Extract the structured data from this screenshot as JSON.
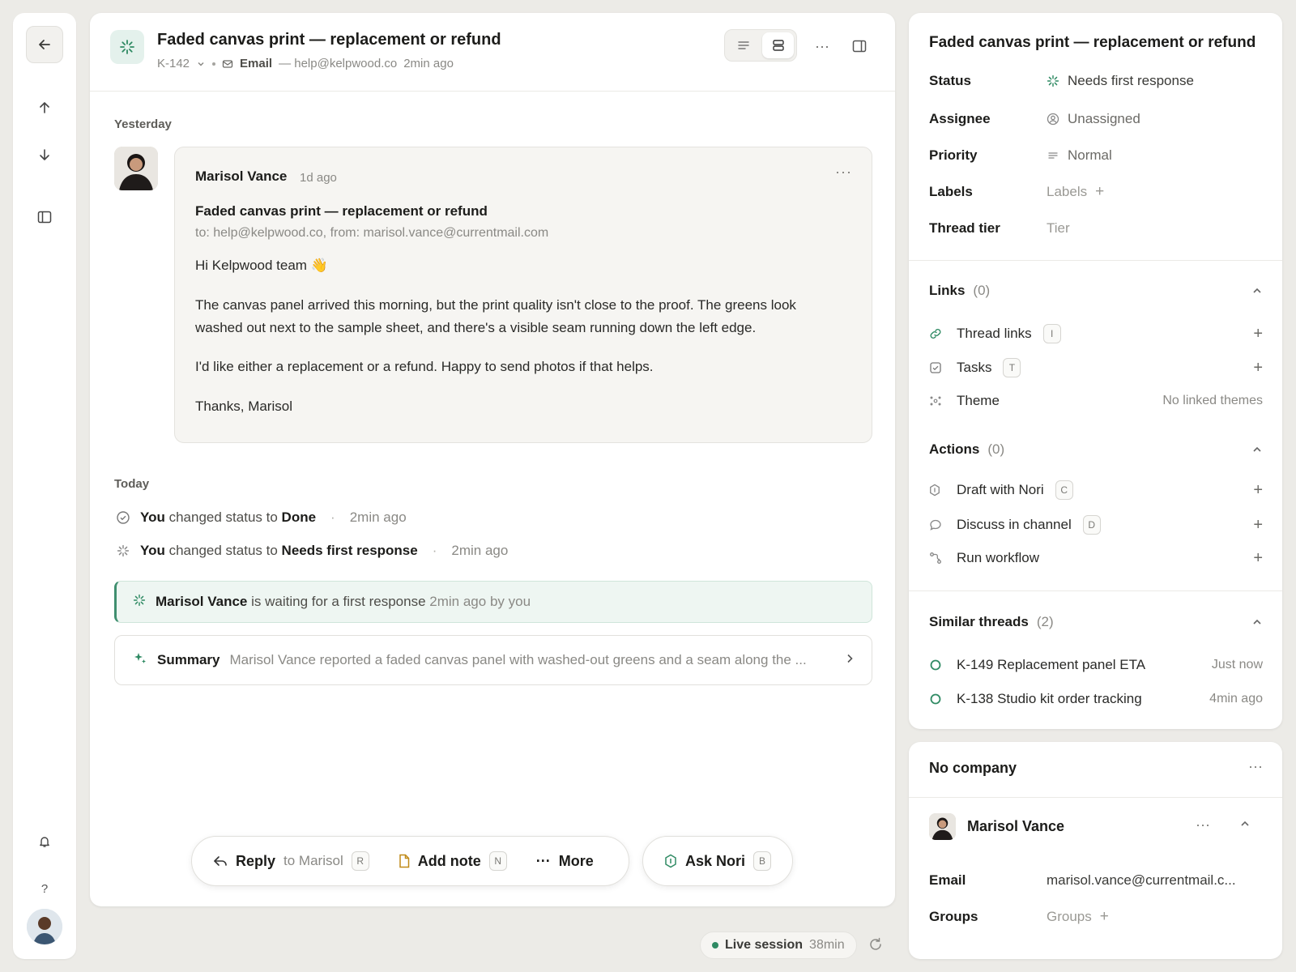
{
  "thread": {
    "title": "Faded canvas print — replacement or refund",
    "id": "K-142",
    "channel": "Email",
    "channel_addr": "— help@kelpwood.co",
    "age": "2min ago"
  },
  "timeline": {
    "yesterday": "Yesterday",
    "today": "Today",
    "message": {
      "sender": "Marisol Vance",
      "age": "1d ago",
      "subject": "Faded canvas print — replacement or refund",
      "addresses": "to: help@kelpwood.co, from: marisol.vance@currentmail.com",
      "greeting": "Hi Kelpwood team 👋",
      "p1": "The canvas panel arrived this morning, but the print quality isn't close to the proof. The greens look washed out next to the sample sheet, and there's a visible seam running down the left edge.",
      "p2": "I'd like either a replacement or a refund. Happy to send photos if that helps.",
      "signoff": "Thanks, Marisol"
    },
    "events": [
      {
        "actor": "You",
        "text": "changed status to",
        "value": "Done",
        "time": "2min ago"
      },
      {
        "actor": "You",
        "text": "changed status to",
        "value": "Needs first response",
        "time": "2min ago"
      }
    ],
    "waiting": {
      "name": "Marisol Vance",
      "text": "is waiting for a first response",
      "meta": "2min ago by you"
    },
    "summary": {
      "label": "Summary",
      "text": "Marisol Vance reported a faded canvas panel with washed-out greens and a seam along the ..."
    }
  },
  "actions_bar": {
    "reply": "Reply",
    "reply_to": "to Marisol",
    "reply_key": "R",
    "note": "Add note",
    "note_key": "N",
    "more": "More",
    "ask": "Ask Nori",
    "ask_key": "B"
  },
  "live": {
    "label": "Live session",
    "duration": "38min"
  },
  "details": {
    "title": "Faded canvas print — replacement or refund",
    "props": [
      {
        "k": "Status",
        "v": "Needs first response"
      },
      {
        "k": "Assignee",
        "v": "Unassigned"
      },
      {
        "k": "Priority",
        "v": "Normal"
      },
      {
        "k": "Labels",
        "v": "Labels"
      },
      {
        "k": "Thread tier",
        "v": "Tier"
      }
    ],
    "links": {
      "title": "Links",
      "count": "(0)",
      "items": [
        {
          "label": "Thread links",
          "key": "I"
        },
        {
          "label": "Tasks",
          "key": "T"
        },
        {
          "label": "Theme",
          "right": "No linked themes"
        }
      ]
    },
    "actions": {
      "title": "Actions",
      "count": "(0)",
      "items": [
        {
          "label": "Draft with Nori",
          "key": "C"
        },
        {
          "label": "Discuss in channel",
          "key": "D"
        },
        {
          "label": "Run workflow"
        }
      ]
    },
    "similar": {
      "title": "Similar threads",
      "count": "(2)",
      "items": [
        {
          "label": "K-149 Replacement panel ETA",
          "time": "Just now"
        },
        {
          "label": "K-138 Studio kit order tracking",
          "time": "4min ago"
        }
      ]
    }
  },
  "customer": {
    "company": "No company",
    "name": "Marisol Vance",
    "email_label": "Email",
    "email": "marisol.vance@currentmail.c...",
    "groups_label": "Groups",
    "groups": "Groups"
  },
  "colors": {
    "accent": "#2f8a63",
    "bg": "#ecebe7"
  }
}
